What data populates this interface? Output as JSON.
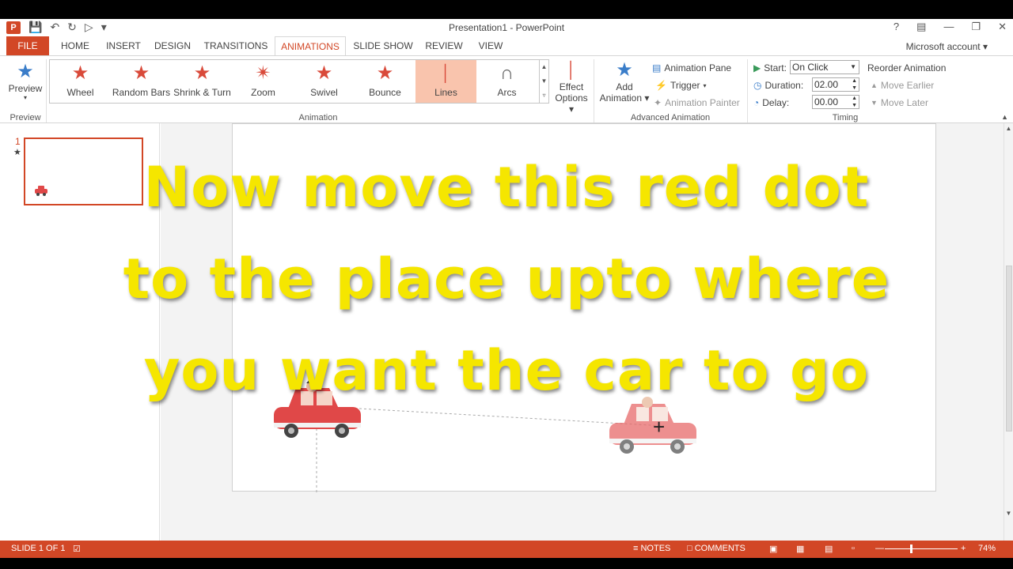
{
  "window": {
    "title": "Presentation1 - PowerPoint",
    "help": "?",
    "account": "Microsoft account"
  },
  "tabs": [
    "FILE",
    "HOME",
    "INSERT",
    "DESIGN",
    "TRANSITIONS",
    "ANIMATIONS",
    "SLIDE SHOW",
    "REVIEW",
    "VIEW"
  ],
  "ribbon": {
    "preview": {
      "label": "Preview",
      "group": "Preview"
    },
    "gallery": {
      "items": [
        "Wheel",
        "Random Bars",
        "Shrink & Turn",
        "Zoom",
        "Swivel",
        "Bounce",
        "Lines",
        "Arcs"
      ],
      "selected": "Lines",
      "group": "Animation"
    },
    "effect_options": {
      "line1": "Effect",
      "line2": "Options"
    },
    "add_animation": {
      "line1": "Add",
      "line2": "Animation"
    },
    "animation_pane": "Animation Pane",
    "trigger": "Trigger",
    "animation_painter": "Animation Painter",
    "advanced_group": "Advanced Animation",
    "timing": {
      "start_label": "Start:",
      "start_value": "On Click",
      "duration_label": "Duration:",
      "duration_value": "02.00",
      "delay_label": "Delay:",
      "delay_value": "00.00",
      "reorder": "Reorder Animation",
      "move_earlier": "Move Earlier",
      "move_later": "Move Later",
      "group": "Timing"
    }
  },
  "thumbnails": {
    "number": "1",
    "star": "★"
  },
  "caption": {
    "line1": "Now move this red dot",
    "line2": "to the place upto where",
    "line3": "you want the car to go"
  },
  "status": {
    "slide": "SLIDE 1 OF 1",
    "notes": "NOTES",
    "comments": "COMMENTS",
    "zoom": "74%"
  },
  "colors": {
    "accent": "#d24726",
    "caption": "#f5e600",
    "car": "#e04848"
  }
}
